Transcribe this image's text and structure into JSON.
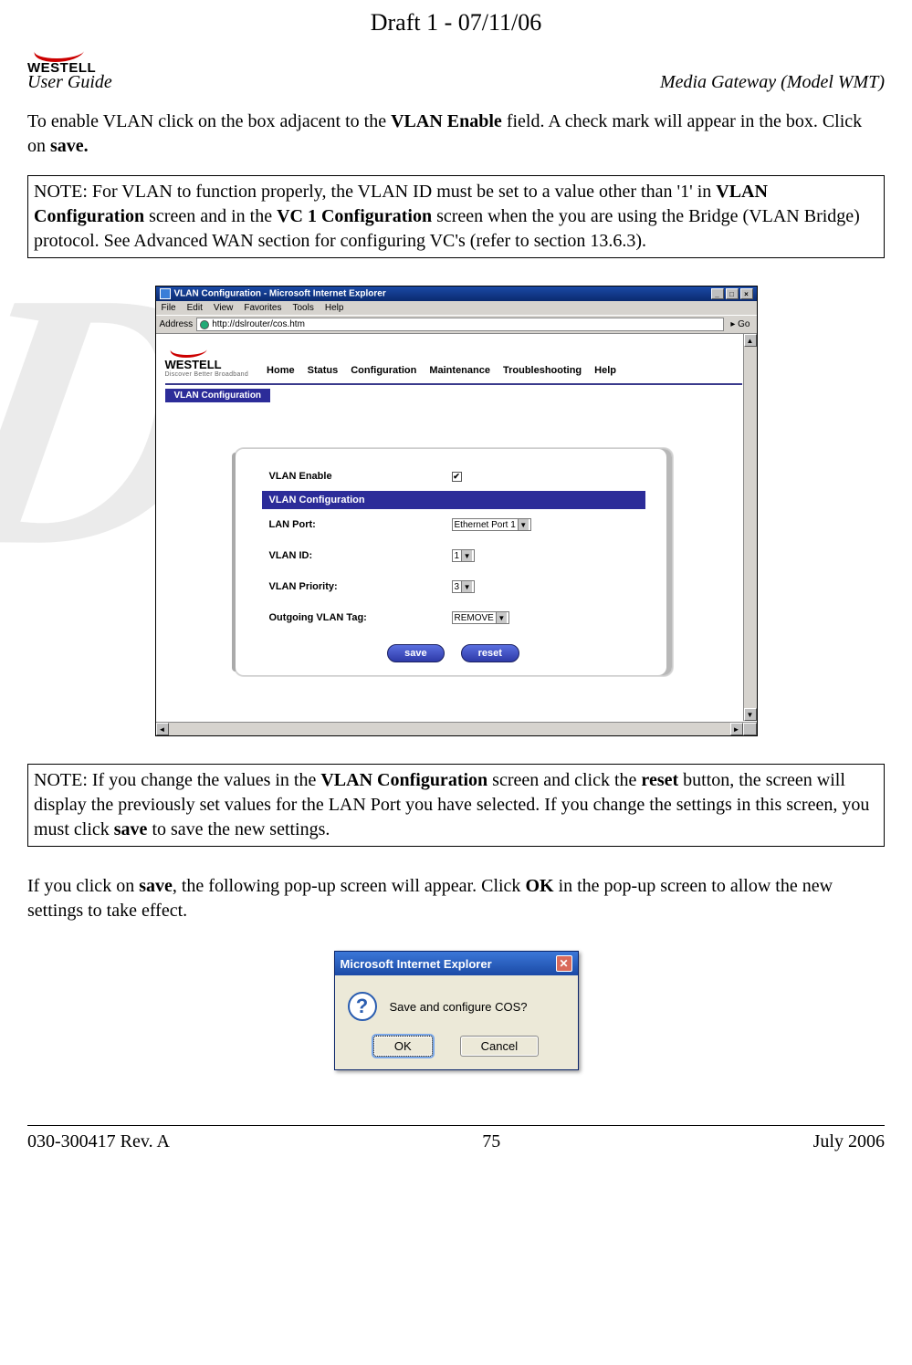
{
  "draft_header": "Draft 1 - 07/11/06",
  "header_left": "User Guide",
  "header_right": "Media Gateway (Model WMT)",
  "logo_text": "WESTELL",
  "para1_pre": "To enable VLAN click on the box adjacent to the ",
  "para1_bold1": "VLAN Enable",
  "para1_mid": " field. A check mark will appear in the box. Click on ",
  "para1_bold2": "save.",
  "note1_pre": "NOTE: For VLAN to function properly, the VLAN ID must be set to a value other than '1' in ",
  "note1_b1": "VLAN Configuration",
  "note1_mid1": " screen and in the ",
  "note1_b2": "VC 1 Configuration",
  "note1_mid2": " screen when the you are using the Bridge (VLAN Bridge) protocol. See Advanced WAN section for configuring VC's (refer to section 13.6.3).",
  "ie": {
    "title": "VLAN Configuration - Microsoft Internet Explorer",
    "menu": {
      "file": "File",
      "edit": "Edit",
      "view": "View",
      "fav": "Favorites",
      "tools": "Tools",
      "help": "Help"
    },
    "address_label": "Address",
    "address_url": "http://dslrouter/cos.htm",
    "go": "Go",
    "logo_text": "WESTELL",
    "logo_tag": "Discover Better Broadband",
    "nav": {
      "home": "Home",
      "status": "Status",
      "config": "Configuration",
      "maint": "Maintenance",
      "trouble": "Troubleshooting",
      "help": "Help"
    },
    "subnav": "VLAN Configuration",
    "panel": {
      "enable_label": "VLAN Enable",
      "enable_checked": "✔",
      "section": "VLAN Configuration",
      "lan_port_label": "LAN Port:",
      "lan_port_value": "Ethernet Port 1",
      "vlan_id_label": "VLAN ID:",
      "vlan_id_value": "1",
      "vlan_prio_label": "VLAN Priority:",
      "vlan_prio_value": "3",
      "out_tag_label": "Outgoing VLAN Tag:",
      "out_tag_value": "REMOVE",
      "save": "save",
      "reset": "reset"
    }
  },
  "note2_pre": "NOTE: If you change the values in the ",
  "note2_b1": "VLAN Configuration",
  "note2_mid1": " screen and click the ",
  "note2_b2": "reset",
  "note2_mid2": " button, the screen will display the previously set values for the LAN Port you have selected. If you change the settings in this screen, you must click ",
  "note2_b3": "save",
  "note2_mid3": " to save the new settings.",
  "para2_pre": "If you click on ",
  "para2_b1": "save",
  "para2_mid1": ", the following pop-up screen will appear. Click ",
  "para2_b2": "OK",
  "para2_mid2": " in the pop-up screen to allow the new settings to take effect.",
  "dlg": {
    "title": "Microsoft Internet Explorer",
    "message": "Save and configure COS?",
    "ok": "OK",
    "cancel": "Cancel"
  },
  "footer": {
    "left": "030-300417 Rev. A",
    "center": "75",
    "right": "July 2006"
  }
}
